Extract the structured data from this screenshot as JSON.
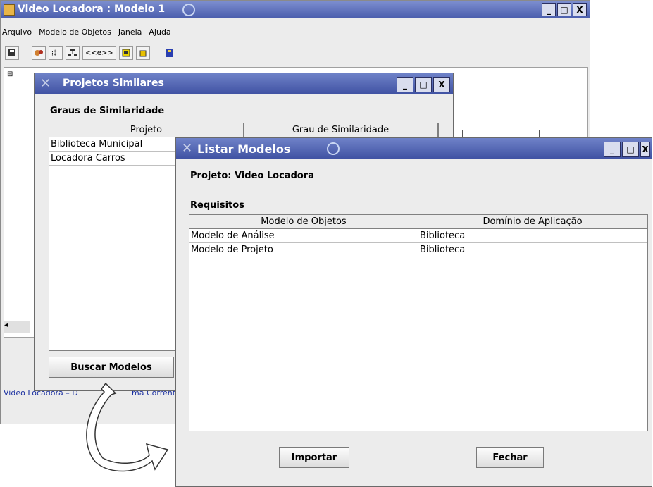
{
  "main_window": {
    "title": "Video Locadora : Modelo 1",
    "menu": [
      "Arquivo",
      "Modelo de Objetos",
      "Janela",
      "Ajuda"
    ],
    "toolbar_buttons": [
      "save-icon",
      "objects-icon",
      "attributes-icon",
      "hierarchy-icon",
      "<<e>>",
      "class-icon",
      "package-icon",
      "book-icon"
    ],
    "status_text": "Video Locadora – D",
    "status_text_2": "ma Corrente:"
  },
  "projetos_similares": {
    "title": "Projetos Similares",
    "heading": "Graus de Similaridade",
    "columns": [
      "Projeto",
      "Grau de Similaridade"
    ],
    "rows": [
      [
        "Biblioteca Municipal",
        ""
      ],
      [
        "Locadora Carros",
        ""
      ]
    ],
    "buscar_label": "Buscar Modelos"
  },
  "listar_modelos": {
    "title": "Listar Modelos",
    "projeto_label": "Projeto: Video Locadora",
    "requisitos_label": "Requisitos",
    "columns": [
      "Modelo de Objetos",
      "Domínio de Aplicação"
    ],
    "rows": [
      [
        "Modelo de Análise",
        "Biblioteca"
      ],
      [
        "Modelo de Projeto",
        "Biblioteca"
      ]
    ],
    "importar_label": "Importar",
    "fechar_label": "Fechar"
  },
  "window_controls": {
    "minimize": "_",
    "maximize": "□",
    "close": "X"
  }
}
